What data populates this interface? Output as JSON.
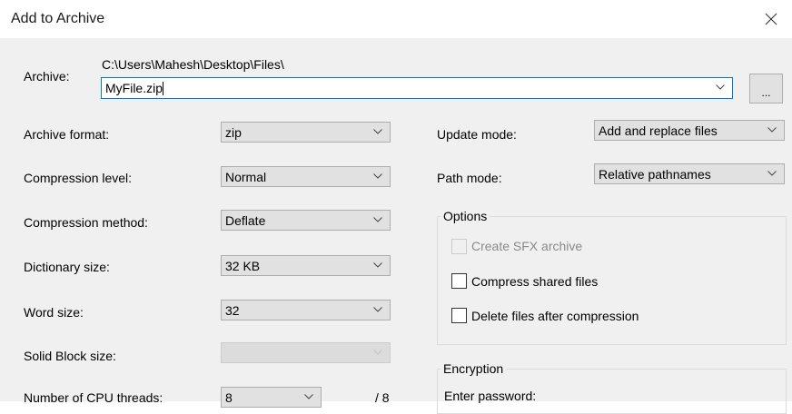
{
  "window": {
    "title": "Add to Archive",
    "close_icon": "close-icon"
  },
  "archive": {
    "label": "Archive:",
    "path": "C:\\Users\\Mahesh\\Desktop\\Files\\",
    "filename": "MyFile.zip",
    "browse_label": "..."
  },
  "left": {
    "archive_format": {
      "label": "Archive format:",
      "value": "zip"
    },
    "compression_level": {
      "label": "Compression level:",
      "value": "Normal"
    },
    "compression_method": {
      "label": "Compression method:",
      "value": "Deflate"
    },
    "dictionary_size": {
      "label": "Dictionary size:",
      "value": "32 KB"
    },
    "word_size": {
      "label": "Word size:",
      "value": "32"
    },
    "solid_block_size": {
      "label": "Solid Block size:",
      "value": ""
    },
    "cpu_threads": {
      "label": "Number of CPU threads:",
      "value": "8",
      "max": "/ 8"
    }
  },
  "right": {
    "update_mode": {
      "label": "Update mode:",
      "value": "Add and replace files"
    },
    "path_mode": {
      "label": "Path mode:",
      "value": "Relative pathnames"
    },
    "options": {
      "title": "Options",
      "create_sfx": "Create SFX archive",
      "compress_shared": "Compress shared files",
      "delete_after": "Delete files after compression"
    },
    "encryption": {
      "title": "Encryption",
      "enter_password": "Enter password:"
    }
  }
}
